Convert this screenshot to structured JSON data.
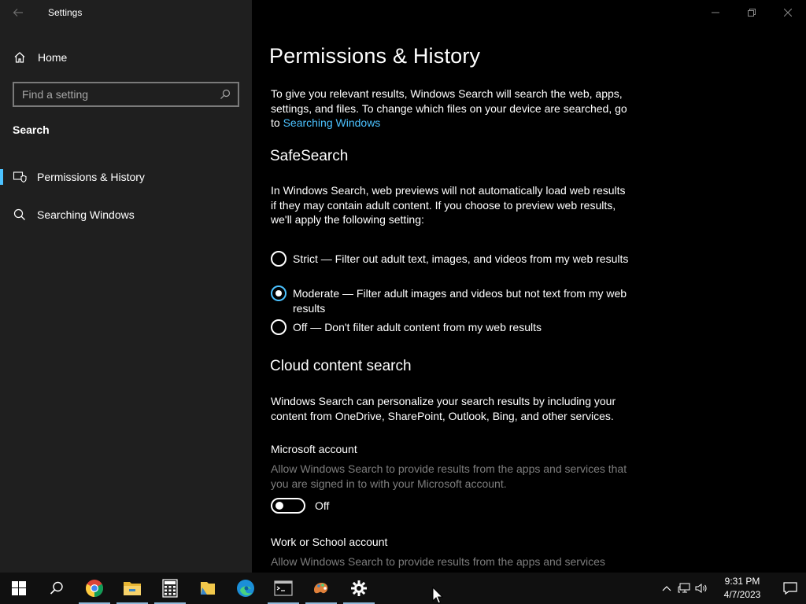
{
  "window": {
    "app_title": "Settings",
    "controls": {
      "minimize": "—",
      "restore": "❐",
      "close": "✕"
    }
  },
  "sidebar": {
    "home_label": "Home",
    "search": {
      "placeholder": "Find a setting",
      "value": ""
    },
    "section_label": "Search",
    "items": [
      {
        "label": "Permissions & History",
        "icon": "shield-icon",
        "selected": true
      },
      {
        "label": "Searching Windows",
        "icon": "search-icon",
        "selected": false
      }
    ]
  },
  "main": {
    "title": "Permissions & History",
    "intro_text": "To give you relevant results, Windows Search will search the web, apps, settings, and files. To change which files on your device are searched, go to ",
    "intro_link": "Searching Windows",
    "safesearch": {
      "heading": "SafeSearch",
      "description": "In Windows Search, web previews will not automatically load web results if they may contain adult content. If you choose to preview web results, we'll apply the following setting:",
      "options": [
        {
          "label": "Strict — Filter out adult text, images, and videos from my web results",
          "checked": false
        },
        {
          "label": "Moderate — Filter adult images and videos but not text from my web results",
          "checked": true
        },
        {
          "label": "Off — Don't filter adult content from my web results",
          "checked": false
        }
      ]
    },
    "cloud": {
      "heading": "Cloud content search",
      "description": "Windows Search can personalize your search results by including your content from OneDrive, SharePoint, Outlook, Bing, and other services.",
      "microsoft_account": {
        "label": "Microsoft account",
        "description": "Allow Windows Search to provide results from the apps and services that you are signed in to with your Microsoft account.",
        "toggle_state": "Off"
      },
      "work_account": {
        "label": "Work or School account",
        "description": "Allow Windows Search to provide results from the apps and services"
      }
    }
  },
  "taskbar": {
    "apps": [
      "start-icon",
      "search-icon",
      "chrome-icon",
      "file-explorer-icon",
      "calculator-icon",
      "folder-app-icon",
      "edge-icon",
      "terminal-icon",
      "paint-icon",
      "settings-icon"
    ],
    "clock_time": "9:31 PM",
    "clock_date": "4/7/2023",
    "colors": {
      "accent": "#4cc2ff",
      "sidebar_bg": "#1f1f1f",
      "main_bg": "#000000",
      "muted_text": "#7d7d7d"
    }
  }
}
